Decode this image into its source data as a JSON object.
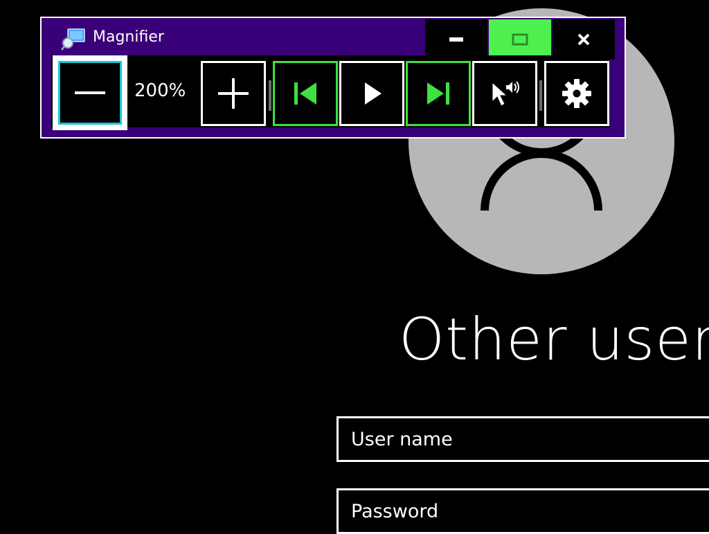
{
  "magnifier": {
    "title": "Magnifier",
    "zoom_level": "200%",
    "icons": {
      "app": "magnifier-app-icon",
      "minimize": "minimize-icon",
      "maximize": "maximize-icon",
      "close": "close-icon",
      "zoom_out": "minus-icon",
      "zoom_in": "plus-icon",
      "previous": "skip-previous-icon",
      "play": "play-icon",
      "next": "skip-next-icon",
      "read_from_pointer": "pointer-speaker-icon",
      "settings": "gear-icon"
    },
    "colors": {
      "titlebar": "#3a0079",
      "accent_green": "#4ef04e",
      "focus_cyan": "#17c7d6"
    }
  },
  "login": {
    "user_display_name": "Other user",
    "username_placeholder": "User name",
    "password_placeholder": "Password",
    "avatar_icon": "user-avatar-icon",
    "colors": {
      "avatar_bg": "#b7b7b7",
      "background": "#000000"
    }
  }
}
